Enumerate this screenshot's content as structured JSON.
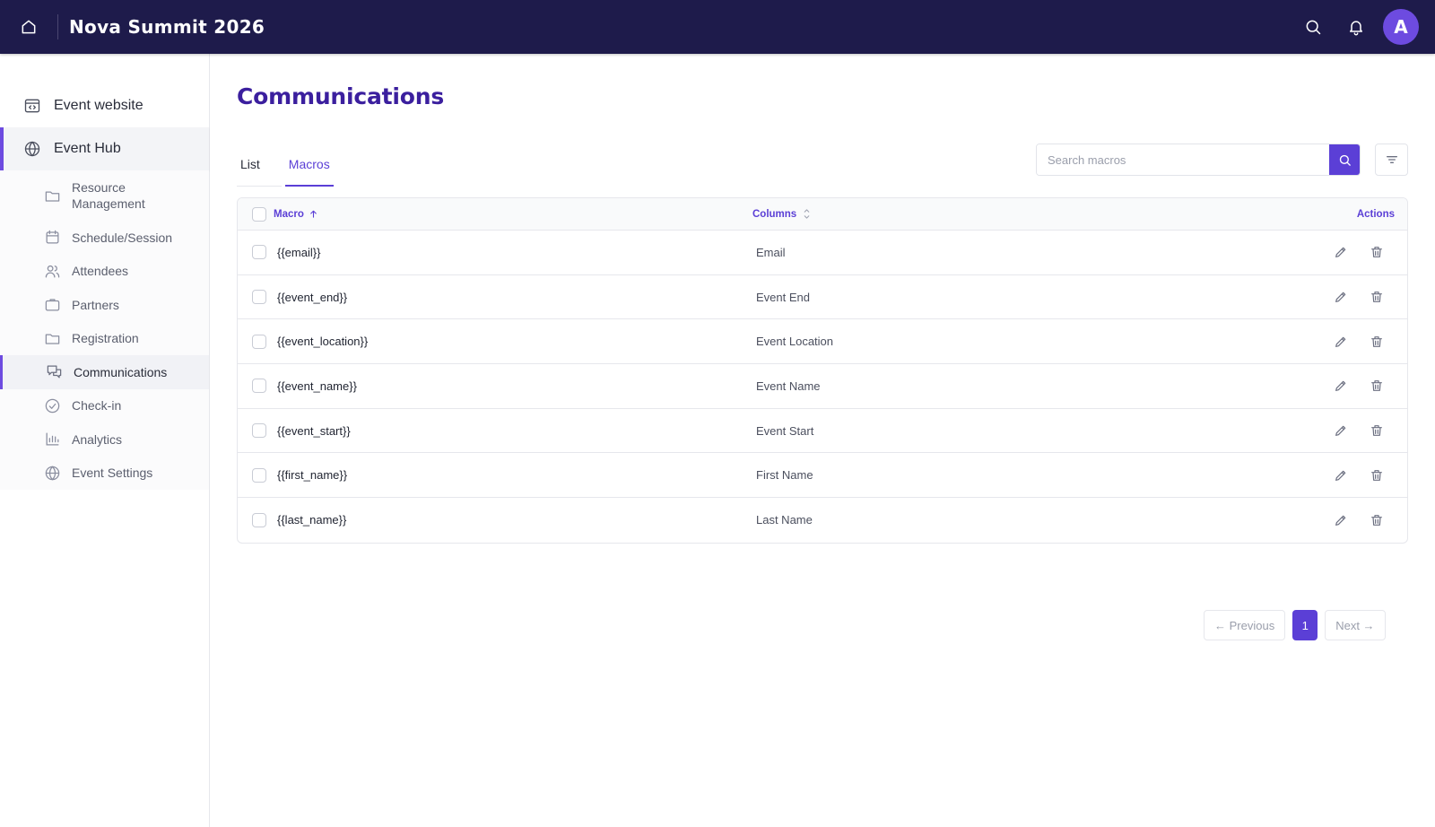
{
  "app": {
    "title": "Nova Summit 2026",
    "avatar_initial": "A",
    "accent_color": "#5b3fd6",
    "topbar_color": "#1e1b4b"
  },
  "sidebar": {
    "event_website": "Event website",
    "event_hub": "Event Hub",
    "items": [
      {
        "label": "Resource\nManagement",
        "icon": "folder-icon"
      },
      {
        "label": "Schedule/Session",
        "icon": "calendar-icon"
      },
      {
        "label": "Attendees",
        "icon": "users-icon"
      },
      {
        "label": "Partners",
        "icon": "briefcase-icon"
      },
      {
        "label": "Registration",
        "icon": "folder-icon"
      },
      {
        "label": "Communications",
        "icon": "chat-icon"
      },
      {
        "label": "Check-in",
        "icon": "check-circle-icon"
      },
      {
        "label": "Analytics",
        "icon": "bar-chart-icon"
      },
      {
        "label": "Event Settings",
        "icon": "globe-icon"
      }
    ],
    "active_item": "Communications"
  },
  "main": {
    "page_title": "Communications",
    "tabs": [
      {
        "label": "List",
        "active": false
      },
      {
        "label": "Macros",
        "active": true
      }
    ],
    "search": {
      "placeholder": "Search macros",
      "value": ""
    },
    "table": {
      "headers": {
        "macro": "Macro",
        "columns": "Columns",
        "actions": "Actions"
      },
      "sort": {
        "column": "Macro",
        "direction": "ascending"
      },
      "rows": [
        {
          "macro": "{{email}}",
          "column": "Email"
        },
        {
          "macro": "{{event_end}}",
          "column": "Event End"
        },
        {
          "macro": "{{event_location}}",
          "column": "Event Location"
        },
        {
          "macro": "{{event_name}}",
          "column": "Event Name"
        },
        {
          "macro": "{{event_start}}",
          "column": "Event Start"
        },
        {
          "macro": "{{first_name}}",
          "column": "First Name"
        },
        {
          "macro": "{{last_name}}",
          "column": "Last Name"
        }
      ]
    },
    "pagination": {
      "previous": "← Previous",
      "current_page": "1",
      "next": "Next →"
    }
  }
}
